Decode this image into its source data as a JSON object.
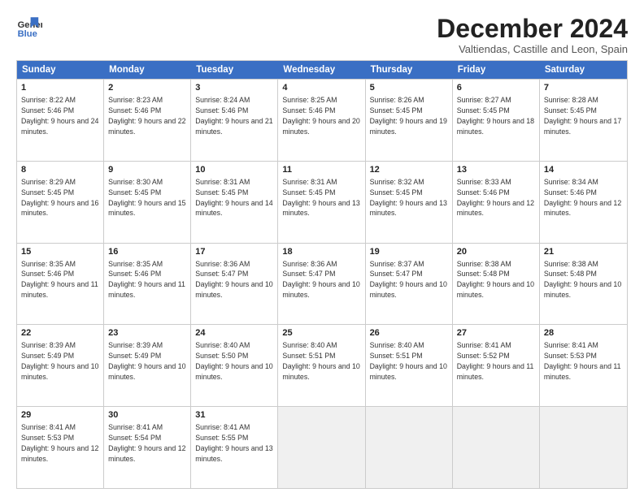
{
  "logo": {
    "line1": "General",
    "line2": "Blue"
  },
  "title": "December 2024",
  "location": "Valtiendas, Castille and Leon, Spain",
  "header_days": [
    "Sunday",
    "Monday",
    "Tuesday",
    "Wednesday",
    "Thursday",
    "Friday",
    "Saturday"
  ],
  "rows": [
    [
      {
        "day": "1",
        "rise": "Sunrise: 8:22 AM",
        "set": "Sunset: 5:46 PM",
        "day_text": "Daylight: 9 hours and 24 minutes."
      },
      {
        "day": "2",
        "rise": "Sunrise: 8:23 AM",
        "set": "Sunset: 5:46 PM",
        "day_text": "Daylight: 9 hours and 22 minutes."
      },
      {
        "day": "3",
        "rise": "Sunrise: 8:24 AM",
        "set": "Sunset: 5:46 PM",
        "day_text": "Daylight: 9 hours and 21 minutes."
      },
      {
        "day": "4",
        "rise": "Sunrise: 8:25 AM",
        "set": "Sunset: 5:46 PM",
        "day_text": "Daylight: 9 hours and 20 minutes."
      },
      {
        "day": "5",
        "rise": "Sunrise: 8:26 AM",
        "set": "Sunset: 5:45 PM",
        "day_text": "Daylight: 9 hours and 19 minutes."
      },
      {
        "day": "6",
        "rise": "Sunrise: 8:27 AM",
        "set": "Sunset: 5:45 PM",
        "day_text": "Daylight: 9 hours and 18 minutes."
      },
      {
        "day": "7",
        "rise": "Sunrise: 8:28 AM",
        "set": "Sunset: 5:45 PM",
        "day_text": "Daylight: 9 hours and 17 minutes."
      }
    ],
    [
      {
        "day": "8",
        "rise": "Sunrise: 8:29 AM",
        "set": "Sunset: 5:45 PM",
        "day_text": "Daylight: 9 hours and 16 minutes."
      },
      {
        "day": "9",
        "rise": "Sunrise: 8:30 AM",
        "set": "Sunset: 5:45 PM",
        "day_text": "Daylight: 9 hours and 15 minutes."
      },
      {
        "day": "10",
        "rise": "Sunrise: 8:31 AM",
        "set": "Sunset: 5:45 PM",
        "day_text": "Daylight: 9 hours and 14 minutes."
      },
      {
        "day": "11",
        "rise": "Sunrise: 8:31 AM",
        "set": "Sunset: 5:45 PM",
        "day_text": "Daylight: 9 hours and 13 minutes."
      },
      {
        "day": "12",
        "rise": "Sunrise: 8:32 AM",
        "set": "Sunset: 5:45 PM",
        "day_text": "Daylight: 9 hours and 13 minutes."
      },
      {
        "day": "13",
        "rise": "Sunrise: 8:33 AM",
        "set": "Sunset: 5:46 PM",
        "day_text": "Daylight: 9 hours and 12 minutes."
      },
      {
        "day": "14",
        "rise": "Sunrise: 8:34 AM",
        "set": "Sunset: 5:46 PM",
        "day_text": "Daylight: 9 hours and 12 minutes."
      }
    ],
    [
      {
        "day": "15",
        "rise": "Sunrise: 8:35 AM",
        "set": "Sunset: 5:46 PM",
        "day_text": "Daylight: 9 hours and 11 minutes."
      },
      {
        "day": "16",
        "rise": "Sunrise: 8:35 AM",
        "set": "Sunset: 5:46 PM",
        "day_text": "Daylight: 9 hours and 11 minutes."
      },
      {
        "day": "17",
        "rise": "Sunrise: 8:36 AM",
        "set": "Sunset: 5:47 PM",
        "day_text": "Daylight: 9 hours and 10 minutes."
      },
      {
        "day": "18",
        "rise": "Sunrise: 8:36 AM",
        "set": "Sunset: 5:47 PM",
        "day_text": "Daylight: 9 hours and 10 minutes."
      },
      {
        "day": "19",
        "rise": "Sunrise: 8:37 AM",
        "set": "Sunset: 5:47 PM",
        "day_text": "Daylight: 9 hours and 10 minutes."
      },
      {
        "day": "20",
        "rise": "Sunrise: 8:38 AM",
        "set": "Sunset: 5:48 PM",
        "day_text": "Daylight: 9 hours and 10 minutes."
      },
      {
        "day": "21",
        "rise": "Sunrise: 8:38 AM",
        "set": "Sunset: 5:48 PM",
        "day_text": "Daylight: 9 hours and 10 minutes."
      }
    ],
    [
      {
        "day": "22",
        "rise": "Sunrise: 8:39 AM",
        "set": "Sunset: 5:49 PM",
        "day_text": "Daylight: 9 hours and 10 minutes."
      },
      {
        "day": "23",
        "rise": "Sunrise: 8:39 AM",
        "set": "Sunset: 5:49 PM",
        "day_text": "Daylight: 9 hours and 10 minutes."
      },
      {
        "day": "24",
        "rise": "Sunrise: 8:40 AM",
        "set": "Sunset: 5:50 PM",
        "day_text": "Daylight: 9 hours and 10 minutes."
      },
      {
        "day": "25",
        "rise": "Sunrise: 8:40 AM",
        "set": "Sunset: 5:51 PM",
        "day_text": "Daylight: 9 hours and 10 minutes."
      },
      {
        "day": "26",
        "rise": "Sunrise: 8:40 AM",
        "set": "Sunset: 5:51 PM",
        "day_text": "Daylight: 9 hours and 10 minutes."
      },
      {
        "day": "27",
        "rise": "Sunrise: 8:41 AM",
        "set": "Sunset: 5:52 PM",
        "day_text": "Daylight: 9 hours and 11 minutes."
      },
      {
        "day": "28",
        "rise": "Sunrise: 8:41 AM",
        "set": "Sunset: 5:53 PM",
        "day_text": "Daylight: 9 hours and 11 minutes."
      }
    ],
    [
      {
        "day": "29",
        "rise": "Sunrise: 8:41 AM",
        "set": "Sunset: 5:53 PM",
        "day_text": "Daylight: 9 hours and 12 minutes."
      },
      {
        "day": "30",
        "rise": "Sunrise: 8:41 AM",
        "set": "Sunset: 5:54 PM",
        "day_text": "Daylight: 9 hours and 12 minutes."
      },
      {
        "day": "31",
        "rise": "Sunrise: 8:41 AM",
        "set": "Sunset: 5:55 PM",
        "day_text": "Daylight: 9 hours and 13 minutes."
      },
      null,
      null,
      null,
      null
    ]
  ]
}
